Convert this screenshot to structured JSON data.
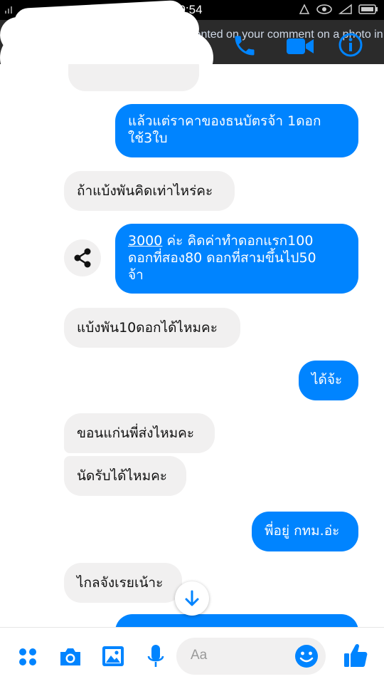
{
  "status_bar": {
    "time": "19:54"
  },
  "header": {
    "notification": "commented on your comment on a photo in"
  },
  "messages": [
    {
      "side": "in",
      "text": ""
    },
    {
      "side": "out",
      "line1": "แล้วแต่ราคาของธนบัตรจ้า 1ดอก",
      "line2": "ใช้3ใบ"
    },
    {
      "side": "in",
      "text": "ถ้าแบ้งพันคิดเท่าไหร่คะ"
    },
    {
      "side": "out",
      "link": "3000",
      "line1_rest": " ค่ะ คิดค่าทำดอกแรก100",
      "line2": "ดอกที่สอง80 ดอกที่สามขึ้นไป50",
      "line3": "จ้า"
    },
    {
      "side": "in",
      "text": "แบ้งพัน10ดอกได้ไหมคะ"
    },
    {
      "side": "out",
      "text": "ได้จ้ะ"
    },
    {
      "side": "in",
      "text": "ขอนแก่นพี่ส่งไหมคะ"
    },
    {
      "side": "in",
      "text": "นัดรับได้ไหมคะ"
    },
    {
      "side": "out",
      "text": "พี่อยู่ กทม.อ่ะ"
    },
    {
      "side": "in",
      "text": "ไกลจังเรยเน้าะ"
    },
    {
      "side": "out",
      "text": ""
    }
  ],
  "composer": {
    "placeholder": "Aa"
  },
  "colors": {
    "accent": "#0084ff",
    "incoming_bubble": "#f1f0f0",
    "header_bg": "#2b2b2b"
  },
  "icons": {
    "header": [
      "phone-icon",
      "video-call-icon",
      "info-icon"
    ],
    "composer": [
      "apps-icon",
      "camera-icon",
      "gallery-icon",
      "microphone-icon",
      "emoji-icon",
      "like-icon"
    ],
    "chat": [
      "share-icon",
      "scroll-down-icon"
    ]
  }
}
